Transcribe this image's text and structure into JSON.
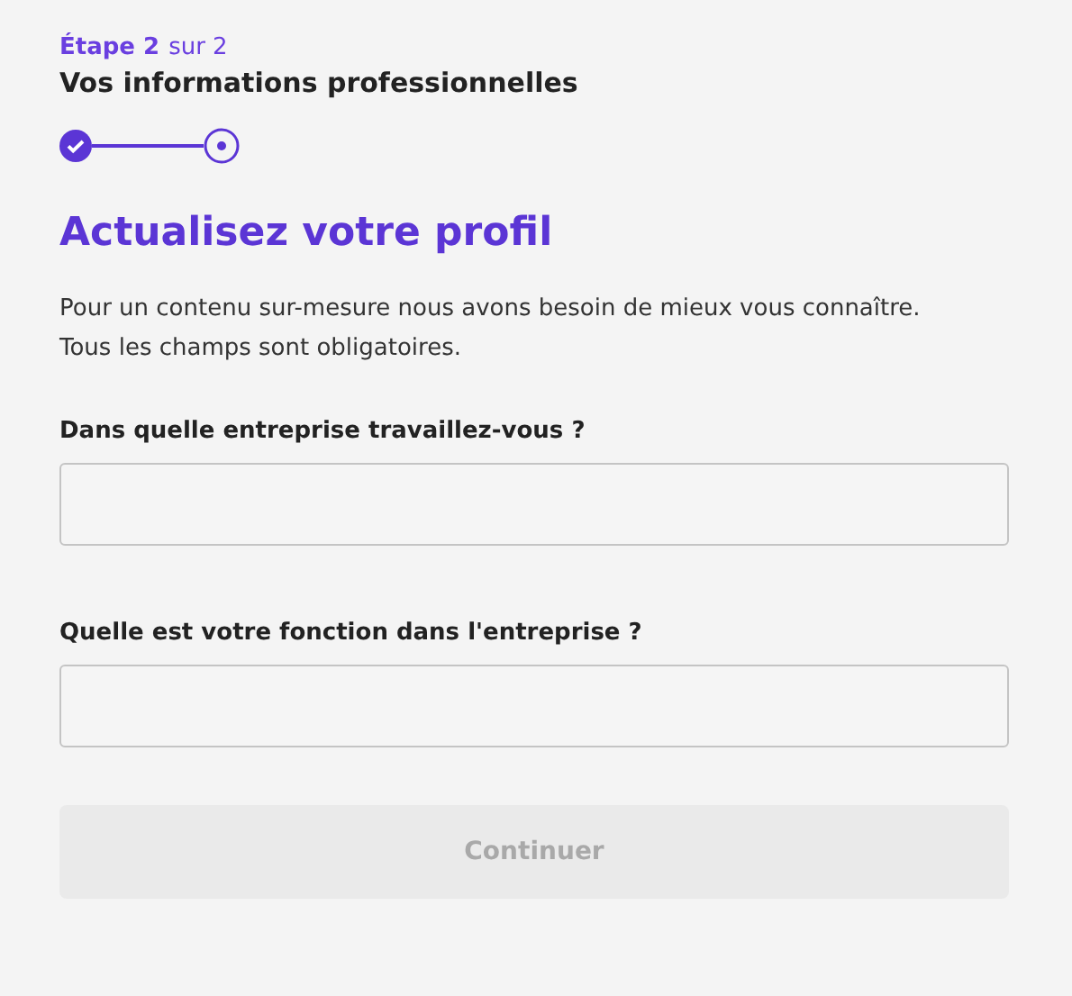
{
  "step": {
    "current": "Étape 2",
    "total": "sur 2"
  },
  "section_title": "Vos informations professionnelles",
  "stepper": [
    {
      "kind": "done"
    },
    {
      "kind": "current"
    }
  ],
  "heading": "Actualisez votre profil",
  "intro": [
    "Pour un contenu sur-mesure nous avons besoin de mieux vous connaître.",
    "Tous les champs sont obligatoires."
  ],
  "fields": [
    {
      "label": "Dans quelle entreprise travaillez-vous ?"
    },
    {
      "label": "Quelle est votre fonction dans l'entreprise ?"
    }
  ],
  "submit": {
    "label": "Continuer",
    "disabled": true
  }
}
